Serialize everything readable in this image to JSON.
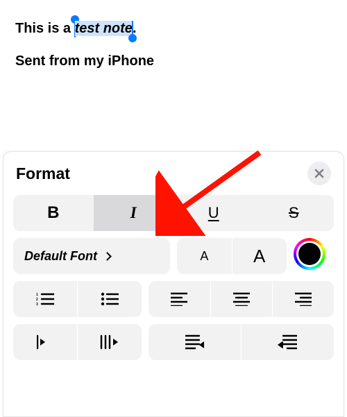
{
  "content": {
    "prefix": "This is a ",
    "selected": "test note",
    "suffix": ".",
    "signature": "Sent from my iPhone"
  },
  "panel": {
    "title": "Format",
    "font_label": "Default Font",
    "small_a": "A",
    "big_a": "A",
    "bold": "B",
    "italic": "I",
    "underline": "U",
    "strike": "S"
  }
}
